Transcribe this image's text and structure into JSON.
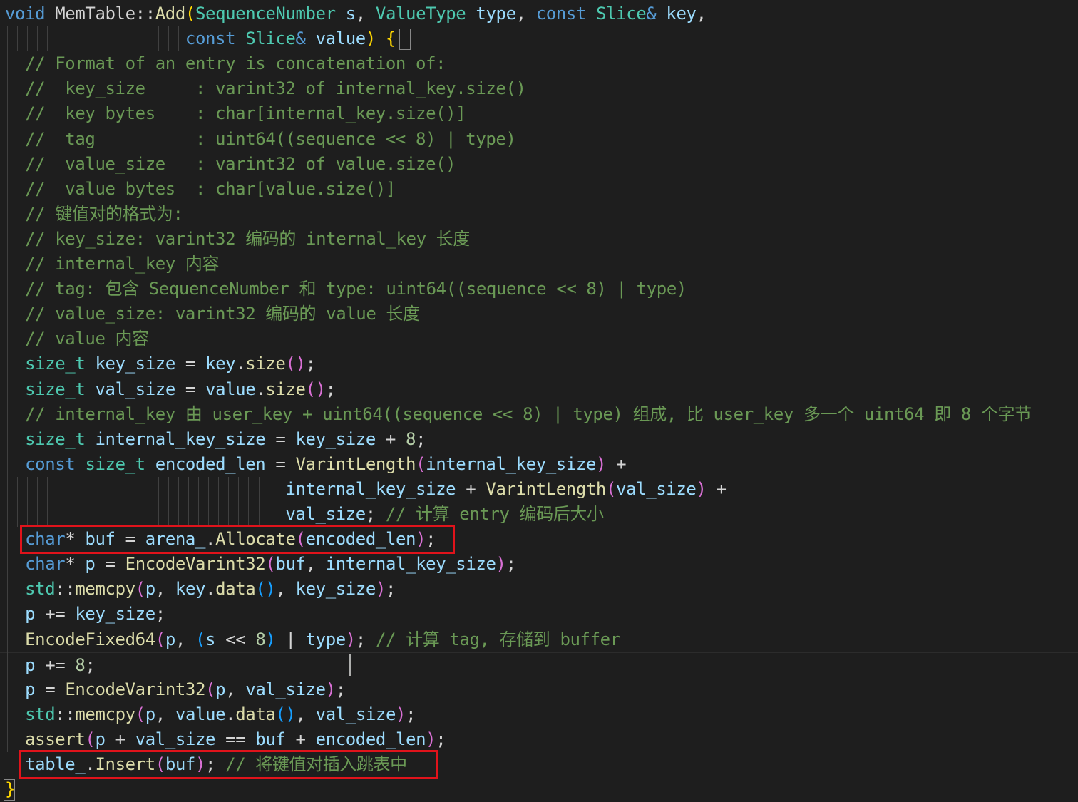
{
  "editor": {
    "language": "cpp",
    "colors": {
      "background": "#1e1e1e",
      "keyword": "#569cd6",
      "type": "#4ec9b0",
      "function": "#dcdcaa",
      "variable": "#9cdcfe",
      "number": "#b5cea8",
      "comment": "#6a9955",
      "plain": "#d4d4d4",
      "highlight_box": "#e0131b"
    },
    "highlighted_lines": [
      21,
      30
    ],
    "current_line": 26,
    "lines": [
      [
        [
          "kw",
          "void"
        ],
        [
          "op",
          " MemTable::"
        ],
        [
          "fn",
          "Add"
        ],
        [
          "br1",
          "("
        ],
        [
          "type",
          "SequenceNumber"
        ],
        [
          "op",
          " "
        ],
        [
          "var",
          "s"
        ],
        [
          "op",
          ", "
        ],
        [
          "type",
          "ValueType"
        ],
        [
          "op",
          " "
        ],
        [
          "var",
          "type"
        ],
        [
          "op",
          ", "
        ],
        [
          "kw",
          "const"
        ],
        [
          "op",
          " "
        ],
        [
          "type",
          "Slice"
        ],
        [
          "kw",
          "&"
        ],
        [
          "op",
          " "
        ],
        [
          "var",
          "key"
        ],
        [
          "op",
          ","
        ]
      ],
      [
        [
          "op",
          "                  "
        ],
        [
          "kw",
          "const"
        ],
        [
          "op",
          " "
        ],
        [
          "type",
          "Slice"
        ],
        [
          "kw",
          "&"
        ],
        [
          "op",
          " "
        ],
        [
          "var",
          "value"
        ],
        [
          "br1",
          ")"
        ],
        [
          "op",
          " "
        ],
        [
          "br1",
          "{"
        ]
      ],
      [
        [
          "op",
          "  "
        ],
        [
          "cm",
          "// Format of an entry is concatenation of:"
        ]
      ],
      [
        [
          "op",
          "  "
        ],
        [
          "cm",
          "//  key_size     : varint32 of internal_key.size()"
        ]
      ],
      [
        [
          "op",
          "  "
        ],
        [
          "cm",
          "//  key bytes    : char[internal_key.size()]"
        ]
      ],
      [
        [
          "op",
          "  "
        ],
        [
          "cm",
          "//  tag          : uint64((sequence << 8) | type)"
        ]
      ],
      [
        [
          "op",
          "  "
        ],
        [
          "cm",
          "//  value_size   : varint32 of value.size()"
        ]
      ],
      [
        [
          "op",
          "  "
        ],
        [
          "cm",
          "//  value bytes  : char[value.size()]"
        ]
      ],
      [
        [
          "op",
          "  "
        ],
        [
          "cm",
          "// 键值对的格式为:"
        ]
      ],
      [
        [
          "op",
          "  "
        ],
        [
          "cm",
          "// key_size: varint32 编码的 internal_key 长度"
        ]
      ],
      [
        [
          "op",
          "  "
        ],
        [
          "cm",
          "// internal_key 内容"
        ]
      ],
      [
        [
          "op",
          "  "
        ],
        [
          "cm",
          "// tag: 包含 SequenceNumber 和 type: uint64((sequence << 8) | type)"
        ]
      ],
      [
        [
          "op",
          "  "
        ],
        [
          "cm",
          "// value_size: varint32 编码的 value 长度"
        ]
      ],
      [
        [
          "op",
          "  "
        ],
        [
          "cm",
          "// value 内容"
        ]
      ],
      [
        [
          "op",
          "  "
        ],
        [
          "type",
          "size_t"
        ],
        [
          "op",
          " "
        ],
        [
          "var",
          "key_size"
        ],
        [
          "op",
          " = "
        ],
        [
          "var",
          "key"
        ],
        [
          "op",
          "."
        ],
        [
          "fn",
          "size"
        ],
        [
          "br2",
          "()"
        ],
        [
          "op",
          ";"
        ]
      ],
      [
        [
          "op",
          "  "
        ],
        [
          "type",
          "size_t"
        ],
        [
          "op",
          " "
        ],
        [
          "var",
          "val_size"
        ],
        [
          "op",
          " = "
        ],
        [
          "var",
          "value"
        ],
        [
          "op",
          "."
        ],
        [
          "fn",
          "size"
        ],
        [
          "br2",
          "()"
        ],
        [
          "op",
          ";"
        ]
      ],
      [
        [
          "op",
          "  "
        ],
        [
          "cm",
          "// internal_key 由 user_key + uint64((sequence << 8) | type) 组成, 比 user_key 多一个 uint64 即 8 个字节"
        ]
      ],
      [
        [
          "op",
          "  "
        ],
        [
          "type",
          "size_t"
        ],
        [
          "op",
          " "
        ],
        [
          "var",
          "internal_key_size"
        ],
        [
          "op",
          " = "
        ],
        [
          "var",
          "key_size"
        ],
        [
          "op",
          " + "
        ],
        [
          "num",
          "8"
        ],
        [
          "op",
          ";"
        ]
      ],
      [
        [
          "op",
          "  "
        ],
        [
          "kw",
          "const"
        ],
        [
          "op",
          " "
        ],
        [
          "type",
          "size_t"
        ],
        [
          "op",
          " "
        ],
        [
          "var",
          "encoded_len"
        ],
        [
          "op",
          " = "
        ],
        [
          "fn",
          "VarintLength"
        ],
        [
          "br2",
          "("
        ],
        [
          "var",
          "internal_key_size"
        ],
        [
          "br2",
          ")"
        ],
        [
          "op",
          " +"
        ]
      ],
      [
        [
          "op",
          "                            "
        ],
        [
          "var",
          "internal_key_size"
        ],
        [
          "op",
          " + "
        ],
        [
          "fn",
          "VarintLength"
        ],
        [
          "br2",
          "("
        ],
        [
          "var",
          "val_size"
        ],
        [
          "br2",
          ")"
        ],
        [
          "op",
          " +"
        ]
      ],
      [
        [
          "op",
          "                            "
        ],
        [
          "var",
          "val_size"
        ],
        [
          "op",
          "; "
        ],
        [
          "cm",
          "// 计算 entry 编码后大小"
        ]
      ],
      [
        [
          "op",
          "  "
        ],
        [
          "kw",
          "char"
        ],
        [
          "op",
          "* "
        ],
        [
          "var",
          "buf"
        ],
        [
          "op",
          " = "
        ],
        [
          "var",
          "arena_"
        ],
        [
          "op",
          "."
        ],
        [
          "fn",
          "Allocate"
        ],
        [
          "br2",
          "("
        ],
        [
          "var",
          "encoded_len"
        ],
        [
          "br2",
          ")"
        ],
        [
          "op",
          ";"
        ]
      ],
      [
        [
          "op",
          "  "
        ],
        [
          "kw",
          "char"
        ],
        [
          "op",
          "* "
        ],
        [
          "var",
          "p"
        ],
        [
          "op",
          " = "
        ],
        [
          "fn",
          "EncodeVarint32"
        ],
        [
          "br2",
          "("
        ],
        [
          "var",
          "buf"
        ],
        [
          "op",
          ", "
        ],
        [
          "var",
          "internal_key_size"
        ],
        [
          "br2",
          ")"
        ],
        [
          "op",
          ";"
        ]
      ],
      [
        [
          "op",
          "  "
        ],
        [
          "type",
          "std"
        ],
        [
          "op",
          "::"
        ],
        [
          "fn",
          "memcpy"
        ],
        [
          "br2",
          "("
        ],
        [
          "var",
          "p"
        ],
        [
          "op",
          ", "
        ],
        [
          "var",
          "key"
        ],
        [
          "op",
          "."
        ],
        [
          "fn",
          "data"
        ],
        [
          "br3",
          "()"
        ],
        [
          "op",
          ", "
        ],
        [
          "var",
          "key_size"
        ],
        [
          "br2",
          ")"
        ],
        [
          "op",
          ";"
        ]
      ],
      [
        [
          "op",
          "  "
        ],
        [
          "var",
          "p"
        ],
        [
          "op",
          " += "
        ],
        [
          "var",
          "key_size"
        ],
        [
          "op",
          ";"
        ]
      ],
      [
        [
          "op",
          "  "
        ],
        [
          "fn",
          "EncodeFixed64"
        ],
        [
          "br2",
          "("
        ],
        [
          "var",
          "p"
        ],
        [
          "op",
          ", "
        ],
        [
          "br3",
          "("
        ],
        [
          "var",
          "s"
        ],
        [
          "op",
          " << "
        ],
        [
          "num",
          "8"
        ],
        [
          "br3",
          ")"
        ],
        [
          "op",
          " | "
        ],
        [
          "var",
          "type"
        ],
        [
          "br2",
          ")"
        ],
        [
          "op",
          "; "
        ],
        [
          "cm",
          "// 计算 tag, 存储到 buffer"
        ]
      ],
      [
        [
          "op",
          "  "
        ],
        [
          "var",
          "p"
        ],
        [
          "op",
          " += "
        ],
        [
          "num",
          "8"
        ],
        [
          "op",
          ";"
        ]
      ],
      [
        [
          "op",
          "  "
        ],
        [
          "var",
          "p"
        ],
        [
          "op",
          " = "
        ],
        [
          "fn",
          "EncodeVarint32"
        ],
        [
          "br2",
          "("
        ],
        [
          "var",
          "p"
        ],
        [
          "op",
          ", "
        ],
        [
          "var",
          "val_size"
        ],
        [
          "br2",
          ")"
        ],
        [
          "op",
          ";"
        ]
      ],
      [
        [
          "op",
          "  "
        ],
        [
          "type",
          "std"
        ],
        [
          "op",
          "::"
        ],
        [
          "fn",
          "memcpy"
        ],
        [
          "br2",
          "("
        ],
        [
          "var",
          "p"
        ],
        [
          "op",
          ", "
        ],
        [
          "var",
          "value"
        ],
        [
          "op",
          "."
        ],
        [
          "fn",
          "data"
        ],
        [
          "br3",
          "()"
        ],
        [
          "op",
          ", "
        ],
        [
          "var",
          "val_size"
        ],
        [
          "br2",
          ")"
        ],
        [
          "op",
          ";"
        ]
      ],
      [
        [
          "op",
          "  "
        ],
        [
          "fn",
          "assert"
        ],
        [
          "br2",
          "("
        ],
        [
          "var",
          "p"
        ],
        [
          "op",
          " + "
        ],
        [
          "var",
          "val_size"
        ],
        [
          "op",
          " == "
        ],
        [
          "var",
          "buf"
        ],
        [
          "op",
          " + "
        ],
        [
          "var",
          "encoded_len"
        ],
        [
          "br2",
          ")"
        ],
        [
          "op",
          ";"
        ]
      ],
      [
        [
          "op",
          "  "
        ],
        [
          "var",
          "table_"
        ],
        [
          "op",
          "."
        ],
        [
          "fn",
          "Insert"
        ],
        [
          "br2",
          "("
        ],
        [
          "var",
          "buf"
        ],
        [
          "br2",
          ")"
        ],
        [
          "op",
          "; "
        ],
        [
          "cm",
          "// 将键值对插入跳表中"
        ]
      ],
      [
        [
          "br1",
          "}"
        ]
      ]
    ]
  }
}
